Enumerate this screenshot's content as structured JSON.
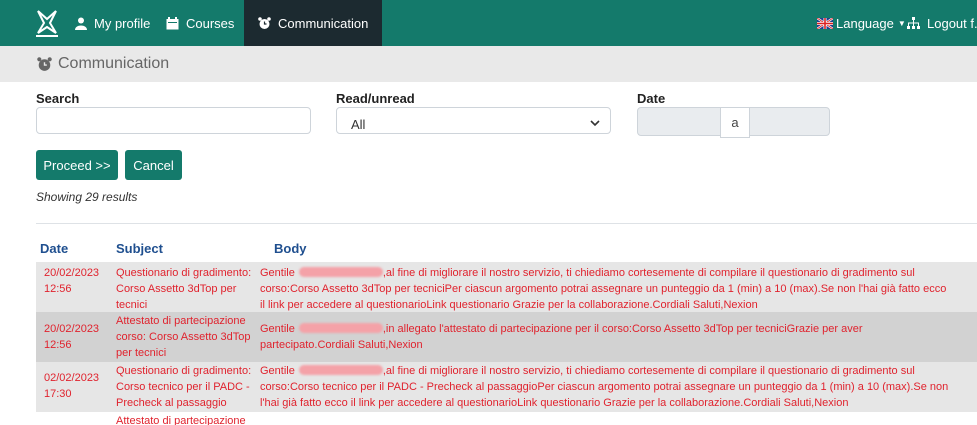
{
  "nav": {
    "items": [
      {
        "label": "My profile",
        "icon": "user-icon"
      },
      {
        "label": "Courses",
        "icon": "calendar-icon"
      },
      {
        "label": "Communication",
        "icon": "alarm-clock-icon"
      }
    ],
    "language": "Language",
    "logout": "Logout f."
  },
  "breadcrumb": {
    "title": "Communication"
  },
  "filters": {
    "search_label": "Search",
    "search_value": "",
    "read_label": "Read/unread",
    "read_value": "All",
    "date_label": "Date",
    "date_sep": "a"
  },
  "actions": {
    "proceed": "Proceed >>",
    "cancel": "Cancel"
  },
  "showing": "Showing 29 results",
  "table": {
    "headers": {
      "date": "Date",
      "subject": "Subject",
      "body": "Body"
    },
    "rows": [
      {
        "date": "20/02/2023 12:56",
        "subject": "Questionario di gradimento: Corso Assetto 3dTop per tecnici",
        "greeting": "Gentile",
        "body": ",al fine di migliorare il nostro servizio, ti chiediamo cortesemente di compilare il questionario di gradimento sul corso:Corso Assetto 3dTop per tecniciPer ciascun argomento potrai assegnare un punteggio da 1 (min) a 10 (max).Se non l'hai già fatto ecco il link per accedere al questionarioLink questionario Grazie per la collaborazione.Cordiali Saluti,Nexion"
      },
      {
        "date": "20/02/2023 12:56",
        "subject": "Attestato di partecipazione corso: Corso Assetto 3dTop per tecnici",
        "greeting": "Gentile",
        "body": ",in allegato l'attestato di partecipazione per il corso:Corso Assetto 3dTop per tecniciGrazie per aver partecipato.Cordiali Saluti,Nexion"
      },
      {
        "date": "02/02/2023 17:30",
        "subject": "Questionario di gradimento: Corso tecnico per il PADC - Precheck al passaggio",
        "greeting": "Gentile",
        "body": ",al fine di migliorare il nostro servizio, ti chiediamo cortesemente di compilare il questionario di gradimento sul corso:Corso tecnico per il PADC - Precheck al passaggioPer ciascun argomento potrai assegnare un punteggio da 1 (min) a 10 (max).Se non l'hai già fatto ecco il link per accedere al questionarioLink questionario Grazie per la collaborazione.Cordiali Saluti,Nexion"
      },
      {
        "date": "",
        "subject": "Attestato di partecipazione",
        "greeting": "",
        "body": ""
      }
    ]
  },
  "colors": {
    "primary": "#147a6b",
    "active_nav": "#1c2a30",
    "text_red": "#e0232e",
    "header_blue": "#1f4f8f",
    "row_shade": "#e6e6e6",
    "row_shade_dark": "#d2d2d2"
  }
}
